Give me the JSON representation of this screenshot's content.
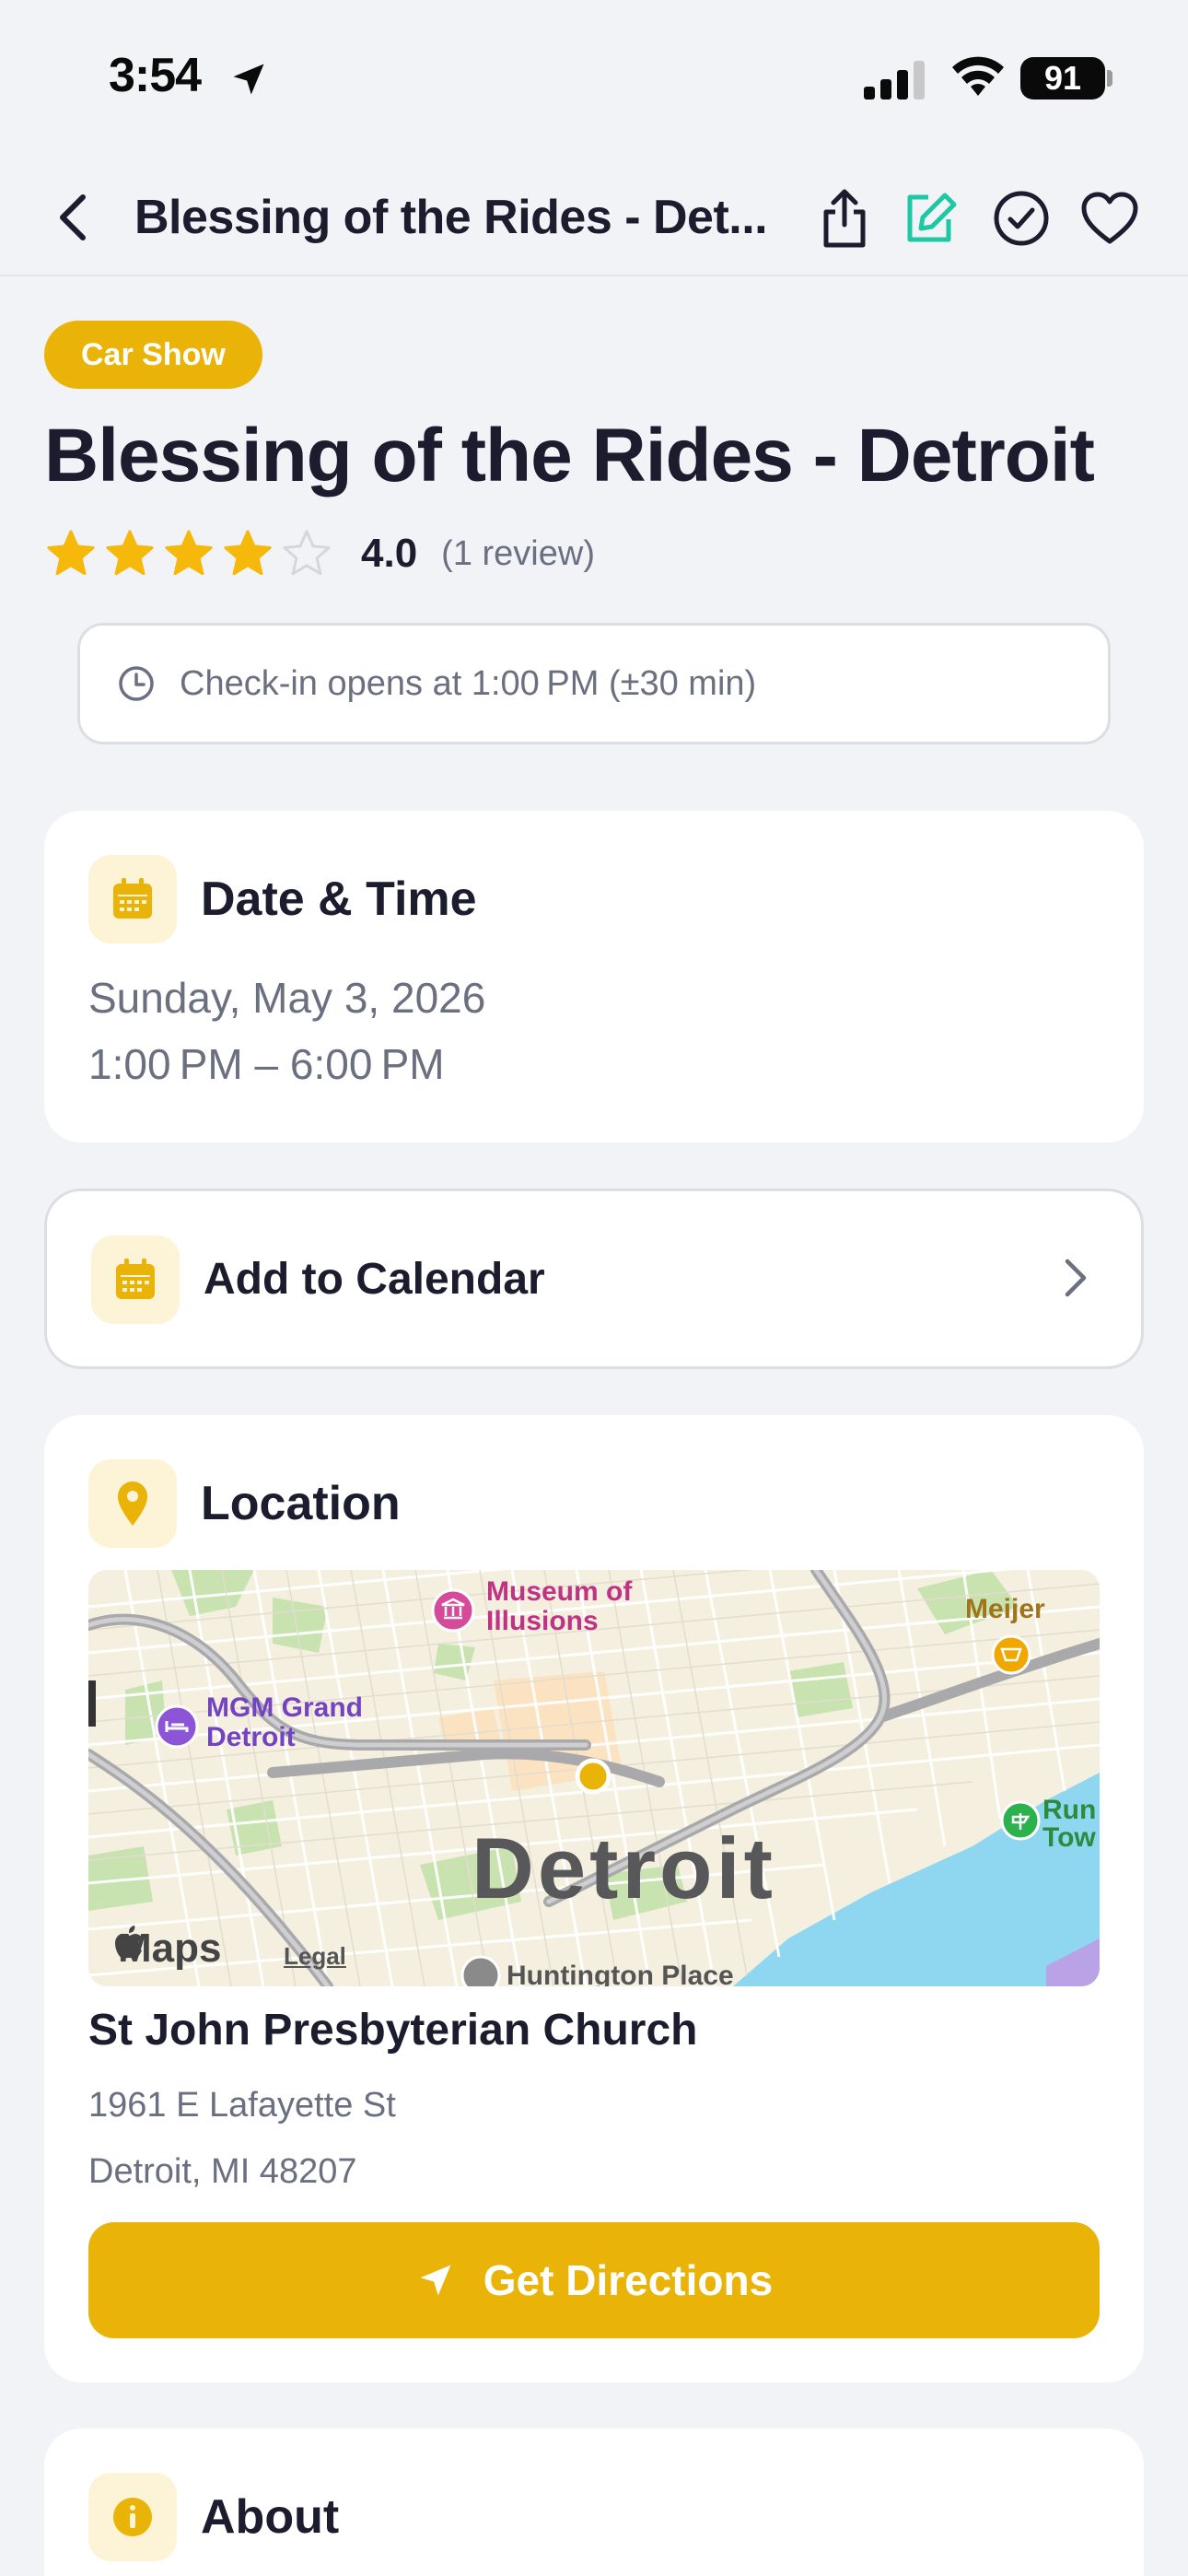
{
  "status_bar": {
    "time": "3:54",
    "battery": "91"
  },
  "header": {
    "title": "Blessing of the Rides - Det..."
  },
  "event": {
    "category": "Car Show",
    "title": "Blessing of the Rides - Detroit",
    "rating": 4.0,
    "rating_text": "4.0",
    "review_count": "(1 review)",
    "checkin": "Check-in opens at 1:00 PM (±30 min)"
  },
  "date_time": {
    "heading": "Date & Time",
    "date": "Sunday, May 3, 2026",
    "time": "1:00 PM – 6:00 PM"
  },
  "calendar": {
    "label": "Add to Calendar"
  },
  "location": {
    "heading": "Location",
    "map": {
      "city_label": "Detroit",
      "poi_museum": "Museum of\nIllusions",
      "poi_museum_l1": "Museum of",
      "poi_museum_l2": "Illusions",
      "poi_mgm_l1": "MGM Grand",
      "poi_mgm_l2": "Detroit",
      "poi_meijer": "Meijer",
      "poi_run_l1": "Run",
      "poi_run_l2": "Tow",
      "poi_huntington": "Huntington Place",
      "attribution": "Maps",
      "legal": "Legal"
    },
    "venue": "St John Presbyterian Church",
    "address_line1": "1961 E Lafayette St",
    "address_line2": "Detroit, MI 48207",
    "directions_label": "Get Directions"
  },
  "about": {
    "heading": "About"
  },
  "colors": {
    "accent": "#e9b308",
    "accent_soft": "#fdf3d6",
    "edit_green": "#1ec8a5"
  }
}
